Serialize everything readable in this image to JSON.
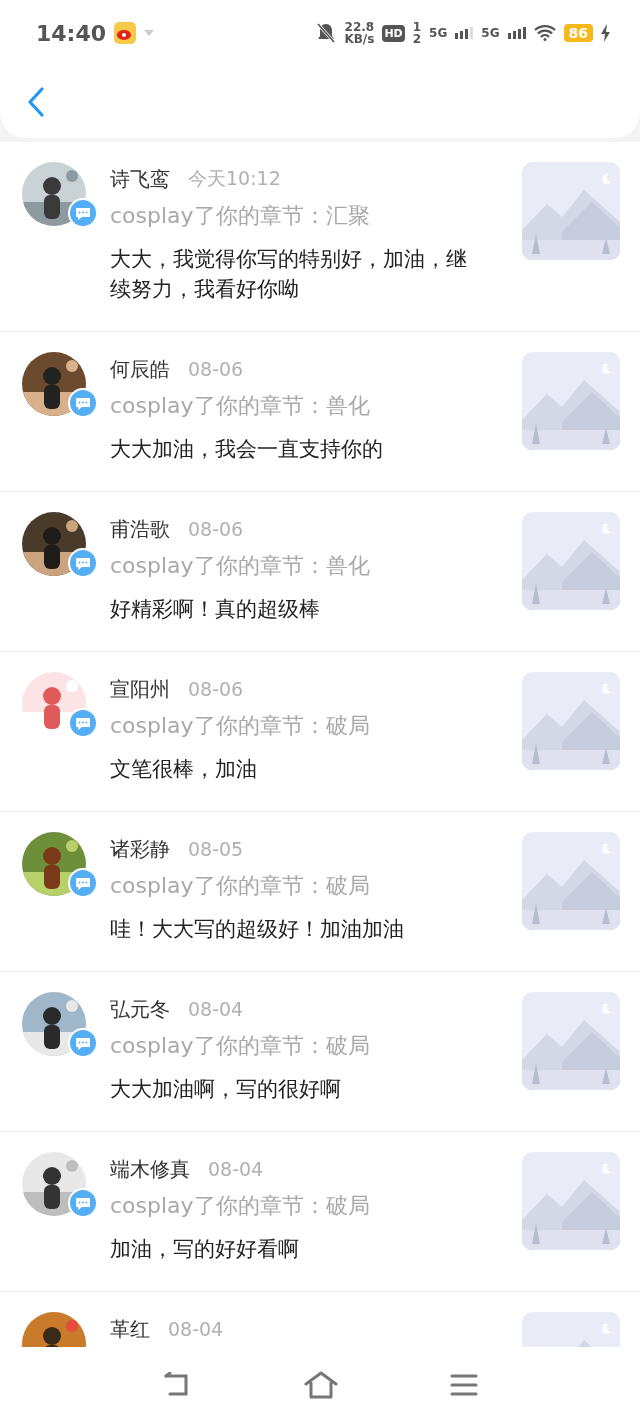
{
  "status_bar": {
    "time": "14:40",
    "speed_value": "22.8",
    "speed_unit": "KB/s",
    "hd_label": "HD",
    "sim_1": "1",
    "sim_2": "2",
    "network_1": "5G",
    "network_2": "5G",
    "battery": "86"
  },
  "notifications": [
    {
      "name": "诗飞鸾",
      "time": "今天10:12",
      "subtitle": "cosplay了你的章节：汇聚",
      "comment": "大大，我觉得你写的特别好，加油，继续努力，我看好你呦"
    },
    {
      "name": "何辰皓",
      "time": "08-06",
      "subtitle": "cosplay了你的章节：兽化",
      "comment": "大大加油，我会一直支持你的"
    },
    {
      "name": "甫浩歌",
      "time": "08-06",
      "subtitle": "cosplay了你的章节：兽化",
      "comment": "好精彩啊！真的超级棒"
    },
    {
      "name": "宣阳州",
      "time": "08-06",
      "subtitle": "cosplay了你的章节：破局",
      "comment": "文笔很棒，加油"
    },
    {
      "name": "诸彩静",
      "time": "08-05",
      "subtitle": "cosplay了你的章节：破局",
      "comment": "哇！大大写的超级好！加油加油"
    },
    {
      "name": "弘元冬",
      "time": "08-04",
      "subtitle": "cosplay了你的章节：破局",
      "comment": "大大加油啊，写的很好啊"
    },
    {
      "name": "端木修真",
      "time": "08-04",
      "subtitle": "cosplay了你的章节：破局",
      "comment": "加油，写的好好看啊"
    },
    {
      "name": "革红",
      "time": "08-04"
    }
  ]
}
